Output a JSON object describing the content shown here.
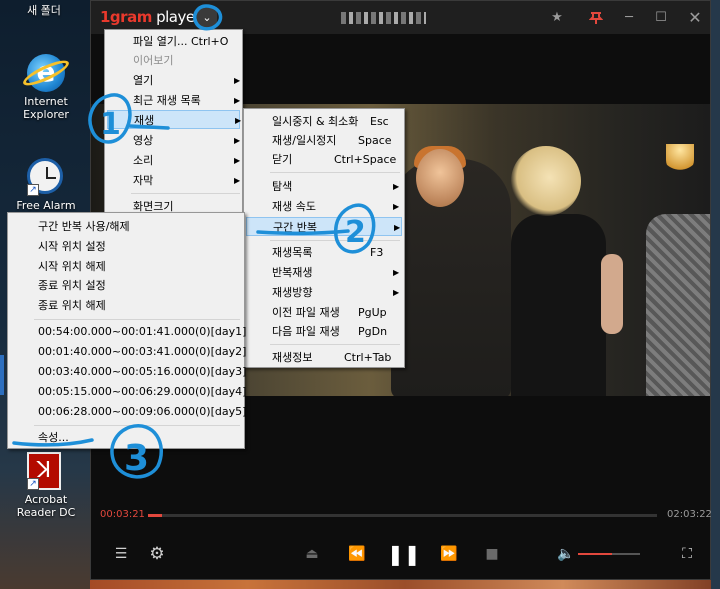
{
  "desktop": {
    "icons": [
      {
        "label": "새 폴더",
        "icon": "folder-icon"
      },
      {
        "label": "Internet Explorer",
        "icon": "internet-explorer-icon"
      },
      {
        "label": "Free Alarm",
        "icon": "alarm-clock-icon"
      },
      {
        "label": "Acrobat Reader DC",
        "icon": "acrobat-icon"
      }
    ]
  },
  "player": {
    "logo_num": "1gram",
    "logo_rest": " playe",
    "menu_toggle_glyph": "⌄",
    "accent_color": "#e2483d",
    "titlebar": {
      "star_glyph": "★",
      "pin_glyph": "📍",
      "min_glyph": "─",
      "max_glyph": "☐",
      "close_glyph": "✕"
    },
    "time_current": "00:03:21",
    "time_total": "02:03:22",
    "progress_fraction": 0.027,
    "volume_fraction": 0.55,
    "controls": {
      "playlist_glyph": "☰",
      "settings_glyph": "⚙",
      "eject_glyph": "⏏",
      "prev_glyph": "⏪",
      "play_glyph": "❚❚",
      "next_glyph": "⏩",
      "stop_glyph": "■",
      "volume_glyph": "🔈",
      "fullscreen_glyph": "⛶"
    }
  },
  "menu_main": {
    "items": [
      {
        "label": "파일 열기... Ctrl+O",
        "arrow": ""
      },
      {
        "label": "이어보기",
        "arrow": ""
      },
      {
        "label": "열기",
        "arrow": "▶"
      },
      {
        "label": "최근 재생 목록",
        "arrow": "▶"
      },
      {
        "label": "재생",
        "arrow": "▶"
      },
      {
        "label": "영상",
        "arrow": "▶"
      },
      {
        "label": "소리",
        "arrow": "▶"
      },
      {
        "label": "자막",
        "arrow": "▶"
      },
      {
        "label": "화면크기",
        "arrow": ""
      }
    ]
  },
  "menu_play": {
    "items": [
      {
        "label": "일시중지 & 최소화",
        "shortcut": "Esc",
        "arrow": ""
      },
      {
        "label": "재생/일시정지",
        "shortcut": "Space",
        "arrow": ""
      },
      {
        "label": "닫기",
        "shortcut": "Ctrl+Space",
        "arrow": ""
      },
      {
        "label": "탐색",
        "shortcut": "",
        "arrow": "▶"
      },
      {
        "label": "재생 속도",
        "shortcut": "",
        "arrow": "▶"
      },
      {
        "label": "구간 반복",
        "shortcut": "",
        "arrow": "▶"
      },
      {
        "label": "재생목록",
        "shortcut": "F3",
        "arrow": ""
      },
      {
        "label": "반복재생",
        "shortcut": "",
        "arrow": "▶"
      },
      {
        "label": "재생방향",
        "shortcut": "",
        "arrow": "▶"
      },
      {
        "label": "이전 파일 재생",
        "shortcut": "PgUp",
        "arrow": ""
      },
      {
        "label": "다음 파일 재생",
        "shortcut": "PgDn",
        "arrow": ""
      },
      {
        "label": "재생정보",
        "shortcut": "Ctrl+Tab",
        "arrow": ""
      }
    ]
  },
  "menu_ab": {
    "items": [
      {
        "label": "구간 반복 사용/해제"
      },
      {
        "label": "시작 위치 설정"
      },
      {
        "label": "시작 위치 해제"
      },
      {
        "label": "종료 위치 설정"
      },
      {
        "label": "종료 위치 해제"
      },
      {
        "label": "00:54:00.000~00:01:41.000(0)[day1]"
      },
      {
        "label": "00:01:40.000~00:03:41.000(0)[day2]"
      },
      {
        "label": "00:03:40.000~00:05:16.000(0)[day3]"
      },
      {
        "label": "00:05:15.000~00:06:29.000(0)[day4]"
      },
      {
        "label": "00:06:28.000~00:09:06.000(0)[day5]"
      },
      {
        "label": "속성..."
      }
    ]
  },
  "annotations": [
    "1",
    "2",
    "3"
  ],
  "annotation_color": "#1e8fd8"
}
